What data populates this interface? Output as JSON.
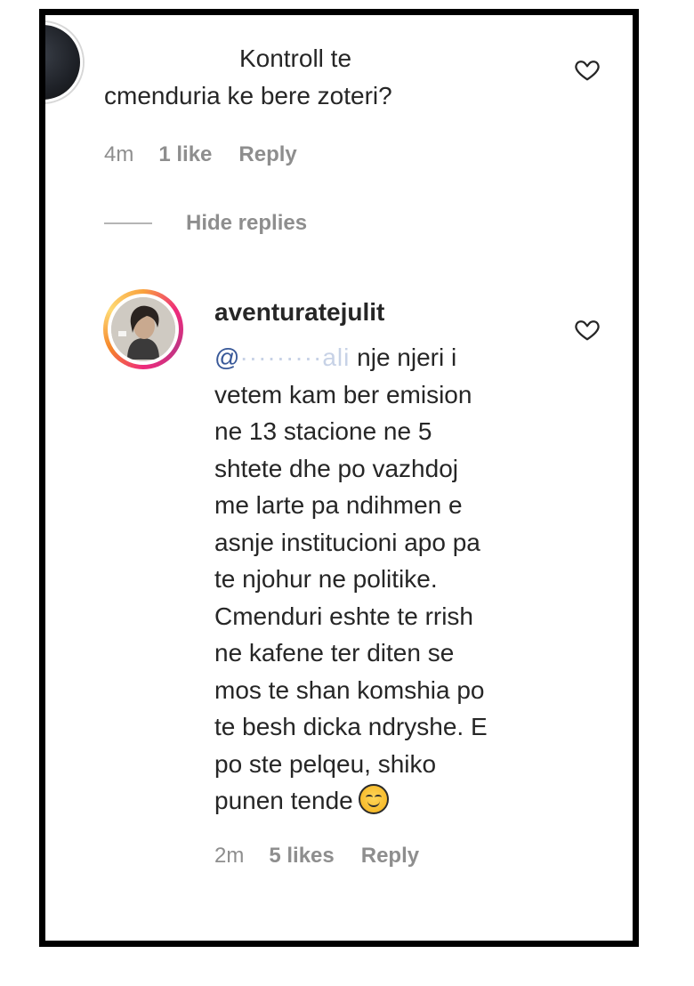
{
  "first_comment": {
    "line1": "Kontroll te",
    "line2": "cmenduria ke bere zoteri?",
    "time": "4m",
    "likes": "1 like",
    "reply": "Reply"
  },
  "replies_toggle": {
    "label": "Hide replies"
  },
  "reply_comment": {
    "username_part1": "aventura",
    "username_part2": "tejulit",
    "mention": "@",
    "mention_blurred": "·········ali",
    "line1_tail": " nje njeri i",
    "lines": [
      "vetem kam ber emision",
      "ne 13 stacione ne 5",
      "shtete dhe po vazhdoj",
      "me larte pa ndihmen e",
      "asnje institucioni apo pa",
      "te njohur ne politike.",
      "Cmenduri eshte te rrish",
      "ne kafene ter diten se",
      "mos te shan komshia po",
      "te besh dicka ndryshe. E",
      "po ste pelqeu, shiko"
    ],
    "last_line": "punen tende",
    "emoji": "smiling-face-emoji",
    "time": "2m",
    "likes": "5 likes",
    "reply": "Reply"
  },
  "icons": {
    "like": "heart-outline-icon"
  }
}
